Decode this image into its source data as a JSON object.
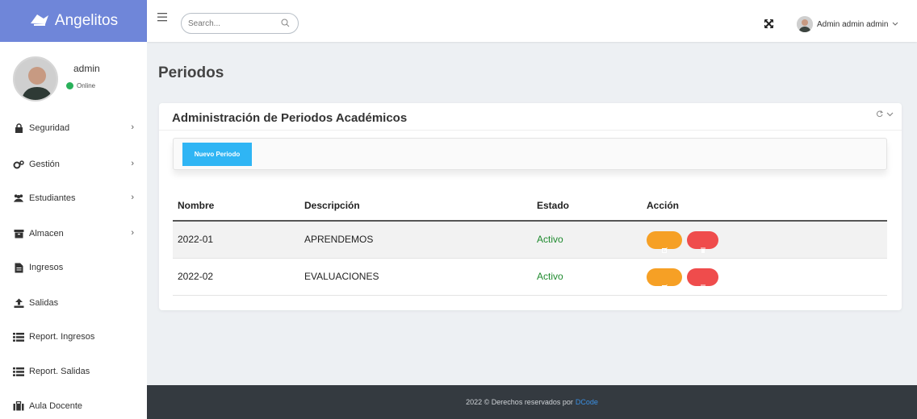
{
  "brand": {
    "name": "Angelitos"
  },
  "user_panel": {
    "name": "admin",
    "status": "Online"
  },
  "sidebar": {
    "items": [
      {
        "label": "Seguridad",
        "icon": "lock-icon",
        "has_children": true
      },
      {
        "label": "Gestión",
        "icon": "cogs-icon",
        "has_children": true
      },
      {
        "label": "Estudiantes",
        "icon": "users-icon",
        "has_children": true
      },
      {
        "label": "Almacen",
        "icon": "archive-icon",
        "has_children": true
      },
      {
        "label": "Ingresos",
        "icon": "file-icon",
        "has_children": false
      },
      {
        "label": "Salidas",
        "icon": "upload-icon",
        "has_children": false
      },
      {
        "label": "Report. Ingresos",
        "icon": "list-icon",
        "has_children": false
      },
      {
        "label": "Report. Salidas",
        "icon": "list-icon",
        "has_children": false
      },
      {
        "label": "Aula Docente",
        "icon": "briefcase-icon",
        "has_children": false
      }
    ]
  },
  "topbar": {
    "search_placeholder": "Search...",
    "user_label": "Admin admin admin"
  },
  "page": {
    "title": "Periodos"
  },
  "card": {
    "title": "Administración de Periodos Académicos",
    "new_button": "Nuevo Periodo"
  },
  "table": {
    "headers": [
      "Nombre",
      "Descripción",
      "Estado",
      "Acción"
    ],
    "rows": [
      {
        "nombre": "2022-01",
        "descripcion": "APRENDEMOS",
        "estado": "Activo"
      },
      {
        "nombre": "2022-02",
        "descripcion": "EVALUACIONES",
        "estado": "Activo"
      }
    ]
  },
  "footer": {
    "text": "2022 © Derechos reservados por",
    "link": "DCode"
  },
  "colors": {
    "brand": "#6f86d9",
    "primary_button": "#2fb5f4",
    "edit": "#f6a025",
    "delete": "#ef4c4c",
    "active": "#1f8a2e",
    "footer_bg": "#343a40"
  }
}
